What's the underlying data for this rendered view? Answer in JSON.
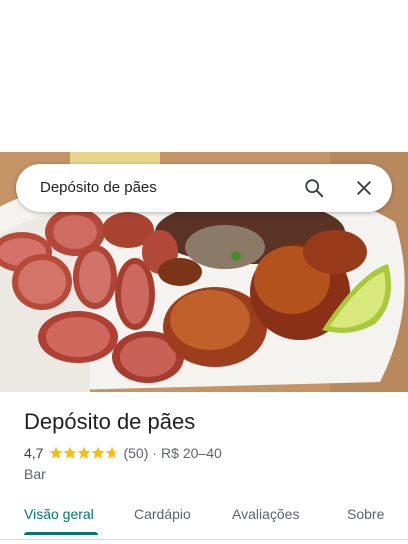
{
  "search": {
    "query": "Depósito de pães"
  },
  "place": {
    "name": "Depósito de pães",
    "rating": "4,7",
    "star_rating": 4.7,
    "review_count": "(50)",
    "separator": "·",
    "price_range": "R$ 20–40",
    "category": "Bar"
  },
  "tabs": [
    {
      "label": "Visão geral",
      "active": true
    },
    {
      "label": "Cardápio",
      "active": false
    },
    {
      "label": "Avaliações",
      "active": false
    },
    {
      "label": "Sobre",
      "active": false
    }
  ],
  "icons": {
    "search": "search-icon",
    "close": "close-icon",
    "star": "star-icon"
  },
  "colors": {
    "accent": "#00786c",
    "star": "#fbbc04",
    "text": "#202124",
    "secondary": "#5f6368"
  }
}
